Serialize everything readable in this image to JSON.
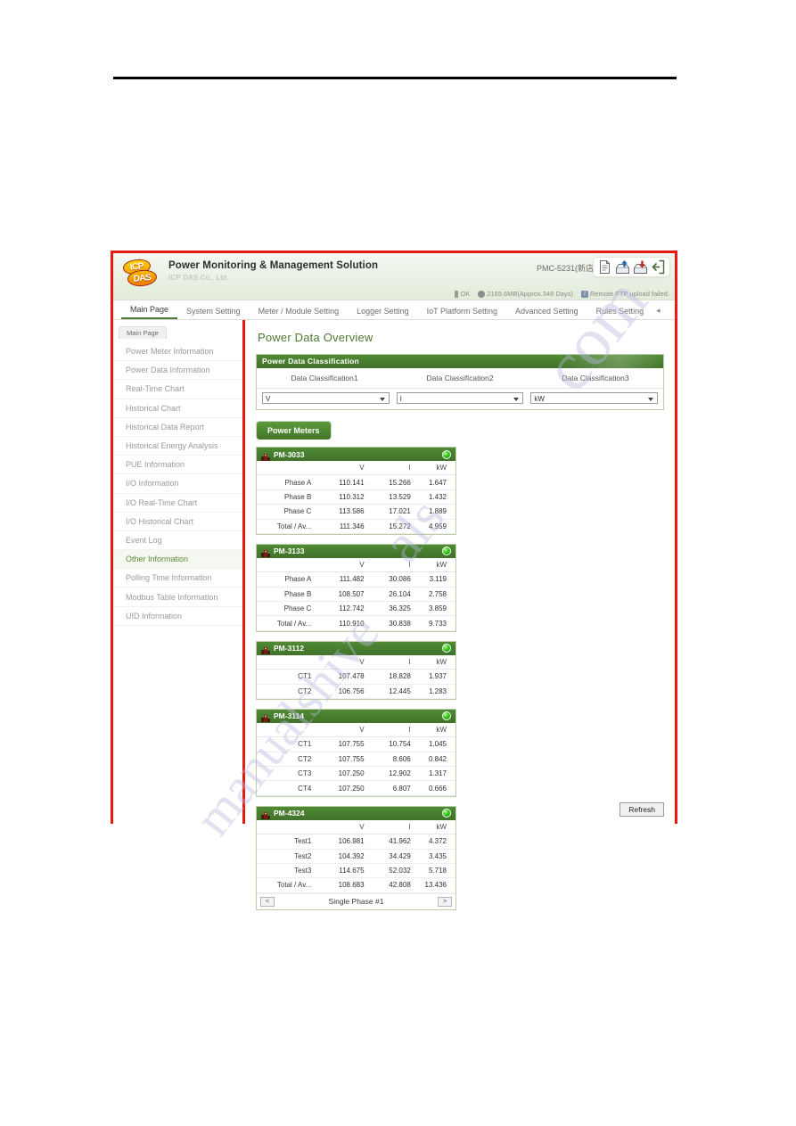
{
  "watermark": {
    "a": "com",
    "b": "manualshive",
    "c": "als"
  },
  "header": {
    "logo_top": "ICP",
    "logo_bottom": "DAS",
    "title": "Power Monitoring & Management Solution",
    "subtitle": "ICP DAS Co., Ltd.",
    "device_name": "PMC-5231(新店)",
    "icons": [
      {
        "name": "document-icon",
        "glyph": "document"
      },
      {
        "name": "upload-icon",
        "glyph": "upload"
      },
      {
        "name": "download-icon",
        "glyph": "download"
      },
      {
        "name": "logout-icon",
        "glyph": "logout"
      }
    ],
    "status": [
      {
        "icon": "battery-icon",
        "text": "OK"
      },
      {
        "icon": "disk-icon",
        "text": "2165.6MB(Approx.348 Days)"
      },
      {
        "icon": "ftp-icon",
        "text": "Remote FTP upload failed."
      }
    ]
  },
  "nav_tabs": [
    "Main Page",
    "System Setting",
    "Meter / Module Setting",
    "Logger Setting",
    "IoT Platform Setting",
    "Advanced Setting",
    "Rules Setting"
  ],
  "nav_more": "◂",
  "sidebar": {
    "tab_label": "Main Page",
    "items": [
      "Power Meter Information",
      "Power Data Information",
      "Real-Time Chart",
      "Historical Chart",
      "Historical Data Report",
      "Historical Energy Analysis",
      "PUE Information",
      "I/O Information",
      "I/O Real-Time Chart",
      "I/O Historical Chart",
      "Event Log",
      "Other Information",
      "Polling Time Information",
      "Modbus Table Information",
      "UID Information"
    ],
    "active_index": 11
  },
  "main": {
    "page_title": "Power Data Overview",
    "classification": {
      "panel_title": "Power Data Classification",
      "labels": [
        "Data Classification1",
        "Data Classification2",
        "Data Classification3"
      ],
      "selects": [
        "V",
        "I",
        "kW"
      ]
    },
    "power_meters_button": "Power Meters",
    "columns": [
      "V",
      "I",
      "kW"
    ],
    "meters": [
      {
        "name": "PM-3033",
        "status": "online",
        "rows": [
          {
            "label": "Phase A",
            "v": "110.141",
            "i": "15.266",
            "kw": "1.647"
          },
          {
            "label": "Phase B",
            "v": "110.312",
            "i": "13.529",
            "kw": "1.432"
          },
          {
            "label": "Phase C",
            "v": "113.586",
            "i": "17.021",
            "kw": "1.889"
          },
          {
            "label": "Total / Av...",
            "v": "111.346",
            "i": "15.272",
            "kw": "4.959"
          }
        ]
      },
      {
        "name": "PM-3133",
        "status": "online",
        "rows": [
          {
            "label": "Phase A",
            "v": "111.482",
            "i": "30.086",
            "kw": "3.119"
          },
          {
            "label": "Phase B",
            "v": "108.507",
            "i": "26.104",
            "kw": "2.758"
          },
          {
            "label": "Phase C",
            "v": "112.742",
            "i": "36.325",
            "kw": "3.859"
          },
          {
            "label": "Total / Av...",
            "v": "110.910",
            "i": "30.838",
            "kw": "9.733"
          }
        ]
      },
      {
        "name": "PM-3112",
        "status": "online",
        "rows": [
          {
            "label": "CT1",
            "v": "107.478",
            "i": "18.828",
            "kw": "1.937"
          },
          {
            "label": "CT2",
            "v": "106.756",
            "i": "12.445",
            "kw": "1.283"
          }
        ]
      },
      {
        "name": "PM-3114",
        "status": "online",
        "rows": [
          {
            "label": "CT1",
            "v": "107.755",
            "i": "10.754",
            "kw": "1.045"
          },
          {
            "label": "CT2",
            "v": "107.755",
            "i": "8.606",
            "kw": "0.842"
          },
          {
            "label": "CT3",
            "v": "107.250",
            "i": "12.902",
            "kw": "1.317"
          },
          {
            "label": "CT4",
            "v": "107.250",
            "i": "6.807",
            "kw": "0.666"
          }
        ]
      },
      {
        "name": "PM-4324",
        "status": "online",
        "rows": [
          {
            "label": "Test1",
            "v": "106.981",
            "i": "41.962",
            "kw": "4.372"
          },
          {
            "label": "Test2",
            "v": "104.392",
            "i": "34.429",
            "kw": "3.435"
          },
          {
            "label": "Test3",
            "v": "114.675",
            "i": "52.032",
            "kw": "5.718"
          },
          {
            "label": "Total / Av...",
            "v": "108.683",
            "i": "42.808",
            "kw": "13.436"
          }
        ],
        "pager": {
          "prev": "<",
          "label": "Single Phase #1",
          "next": ">"
        }
      }
    ],
    "refresh_button": "Refresh"
  },
  "colors": {
    "brand_green": "#4f8a34",
    "frame_red": "#e8190f",
    "led_green": "#33c714"
  }
}
